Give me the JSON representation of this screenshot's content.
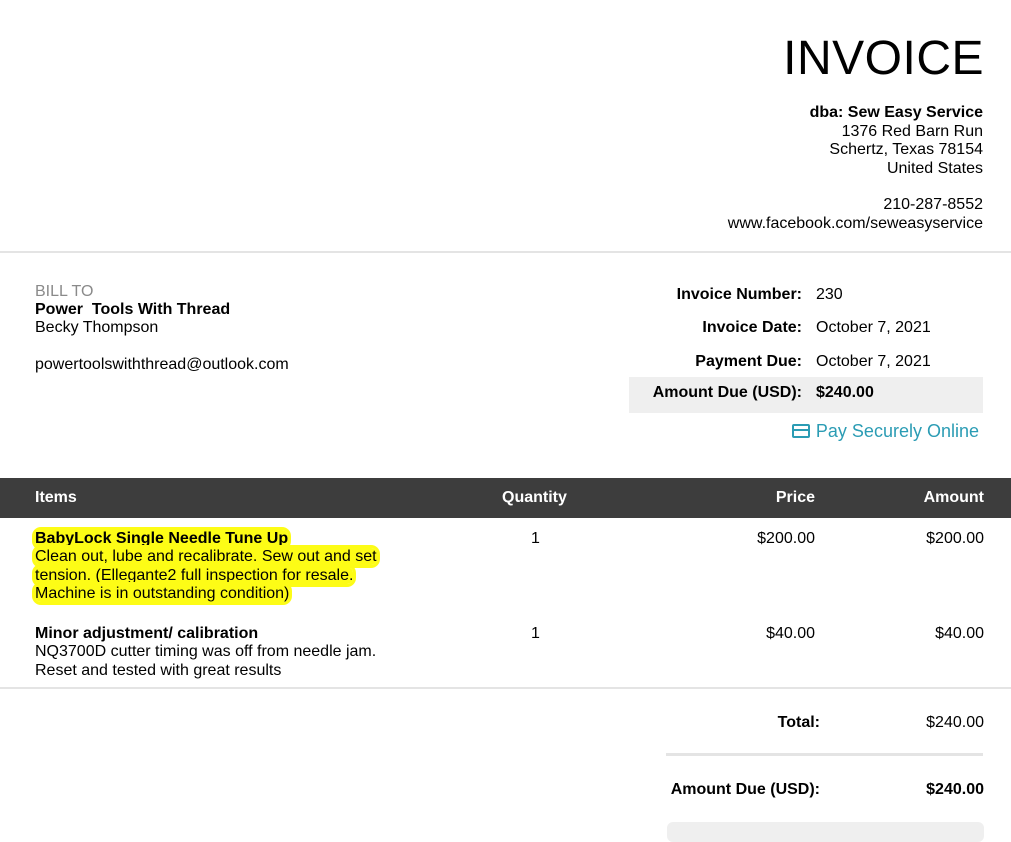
{
  "invoice": {
    "title": "INVOICE",
    "company": {
      "name": "dba: Sew Easy Service",
      "street": "1376 Red Barn Run",
      "city": "Schertz, Texas 78154",
      "country": "United States",
      "phone": "210-287-8552",
      "website": "www.facebook.com/seweasyservice"
    },
    "bill_to": {
      "label": "BILL TO",
      "name": "Power  Tools With Thread",
      "contact": "Becky Thompson",
      "email": "powertoolswiththread@outlook.com"
    },
    "meta": {
      "invoice_number_label": "Invoice Number:",
      "invoice_number": "230",
      "invoice_date_label": "Invoice Date:",
      "invoice_date": "October 7, 2021",
      "payment_due_label": "Payment Due:",
      "payment_due": "October 7, 2021",
      "amount_due_label": "Amount Due (USD):",
      "amount_due": "$240.00"
    },
    "pay_link": "Pay Securely Online",
    "table": {
      "headers": {
        "items": "Items",
        "quantity": "Quantity",
        "price": "Price",
        "amount": "Amount"
      },
      "rows": [
        {
          "title": "BabyLock Single Needle Tune Up",
          "desc": [
            "Clean out, lube and recalibrate. Sew out and set",
            "tension. (Ellegante2 full inspection for resale.",
            "Machine is in outstanding condition)"
          ],
          "quantity": "1",
          "price": "$200.00",
          "amount": "$200.00",
          "highlighted": true
        },
        {
          "title": "Minor adjustment/ calibration",
          "desc": [
            "NQ3700D cutter timing was off from needle jam.",
            "Reset and tested with great results"
          ],
          "quantity": "1",
          "price": "$40.00",
          "amount": "$40.00",
          "highlighted": false
        }
      ]
    },
    "totals": {
      "total_label": "Total:",
      "total": "$240.00",
      "amount_due_label": "Amount Due (USD):",
      "amount_due": "$240.00"
    },
    "colors": {
      "header_bg": "#3d3d3d",
      "link": "#2b9cb4",
      "highlight": "#fdfc16",
      "muted_label": "#8a8a8a"
    },
    "icons": {
      "pay_link_icon": "credit-card-icon"
    }
  }
}
